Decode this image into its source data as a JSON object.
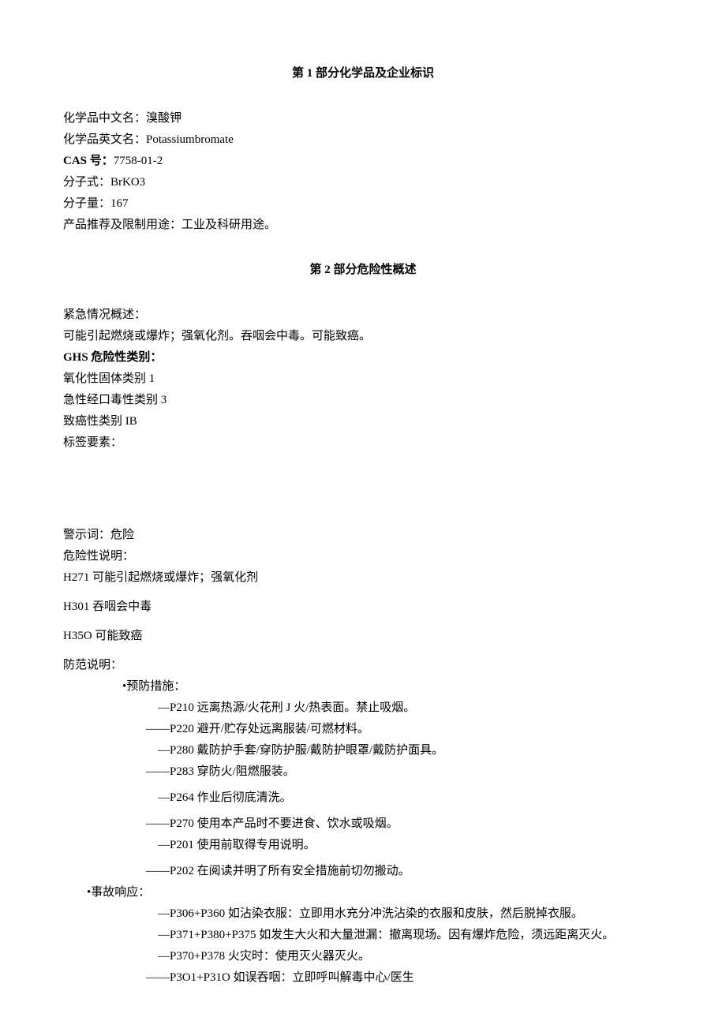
{
  "section1": {
    "title": "第 1 部分化学品及企业标识",
    "fields": {
      "cn_name_label": "化学品中文名：",
      "cn_name_value": "溴酸钾",
      "en_name_label": "化学品英文名：",
      "en_name_value": "Potassiumbromate",
      "cas_label": "CAS 号：",
      "cas_value": "7758-01-2",
      "formula_label": "分子式：",
      "formula_value": "BrKO3",
      "mw_label": "分子量：",
      "mw_value": "167",
      "use_label": "产品推荐及限制用途：",
      "use_value": "工业及科研用途。"
    }
  },
  "section2": {
    "title": "第 2 部分危险性概述",
    "emergency_label": "紧急情况概述：",
    "emergency_text": "可能引起燃烧或爆炸；强氧化剂。吞咽会中毒。可能致癌。",
    "ghs_label": "GHS 危险性类别：",
    "ghs_items": [
      "氧化性固体类别 1",
      "急性经口毒性类别 3",
      "致癌性类别 IB"
    ],
    "label_elements": "标签要素：",
    "signal_word": "警示词：危险",
    "hazard_label": "危险性说明：",
    "hazard_statements": {
      "h271": "H271 可能引起燃烧或爆炸；强氧化剂",
      "h301": "H301 吞咽会中毒",
      "h350": "H35O 可能致癌"
    },
    "precaution_label": "防范说明：",
    "prevention_label": "•预防措施：",
    "prevention_items": [
      "—P210 远离热源/火花刑 J 火/热表面。禁止吸烟。",
      "——P220 避开/贮存处远离服装/可燃材料。",
      "—P280 戴防护手套/穿防护服/戴防护眼罩/戴防护面具。",
      "——P283 穿防火/阻燃服装。",
      "—P264 作业后彻底清洗。",
      "——P270 使用本产品时不要进食、饮水或吸烟。",
      "—P201 使用前取得专用说明。",
      "——P202 在阅读并明了所有安全措施前切勿搬动。"
    ],
    "response_label": "•事故响应：",
    "response_items": [
      "—P306+P360 如沾染衣服：立即用水充分冲洗沾染的衣服和皮肤，然后脱掉衣服。",
      "—P371+P380+P375 如发生大火和大量泄漏：撤离现场。因有爆炸危险，须远距离灭火。",
      "—P370+P378 火灾时：使用灭火器灭火。",
      "——P3O1+P31O 如误吞咽：立即呼叫解毒中心/医生"
    ]
  }
}
